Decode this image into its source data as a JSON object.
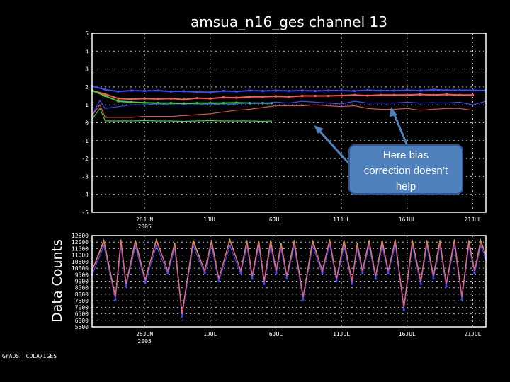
{
  "chart_data": [
    {
      "type": "line",
      "title": "amsua_n16_ges channel 13",
      "xlabel": "",
      "ylabel": "",
      "xlim_days": [
        0,
        30
      ],
      "ylim": [
        -5,
        5
      ],
      "yticks": [
        5,
        4,
        3,
        2,
        1,
        0,
        -1,
        -2,
        -3,
        -4,
        -5
      ],
      "xticks": [
        {
          "day": 4,
          "label": "26JUN",
          "sub": "2005"
        },
        {
          "day": 9,
          "label": "1JUL"
        },
        {
          "day": 14,
          "label": "6JUL"
        },
        {
          "day": 19,
          "label": "11JUL"
        },
        {
          "day": 24,
          "label": "16JUL"
        },
        {
          "day": 29,
          "label": "21JUL"
        }
      ],
      "grid": true,
      "series": [
        {
          "name": "blue-upper",
          "color": "#3a4dff",
          "x": [
            0,
            1,
            2,
            3,
            4,
            5,
            6,
            7,
            8,
            9,
            10,
            11,
            12,
            13,
            14,
            15,
            16,
            17,
            18,
            19,
            20,
            21,
            22,
            23,
            24,
            25,
            26,
            27,
            28,
            29,
            30
          ],
          "values": [
            2.05,
            1.85,
            1.75,
            1.8,
            1.78,
            1.8,
            1.75,
            1.76,
            1.72,
            1.7,
            1.78,
            1.75,
            1.8,
            1.78,
            1.8,
            1.78,
            1.8,
            1.78,
            1.8,
            1.8,
            1.78,
            1.82,
            1.8,
            1.8,
            1.82,
            1.8,
            1.85,
            1.82,
            1.82,
            1.82,
            1.8
          ]
        },
        {
          "name": "red-upper",
          "color": "#ff5a50",
          "x": [
            0,
            1,
            2,
            3,
            4,
            5,
            6,
            7,
            8,
            9,
            10,
            11,
            12,
            13,
            14,
            15,
            16,
            17,
            18,
            19,
            20,
            21,
            22,
            23,
            24,
            25,
            26,
            27,
            28,
            29
          ],
          "values": [
            1.8,
            1.6,
            1.35,
            1.32,
            1.35,
            1.33,
            1.35,
            1.3,
            1.38,
            1.35,
            1.42,
            1.4,
            1.45,
            1.45,
            1.48,
            1.45,
            1.5,
            1.5,
            1.5,
            1.52,
            1.55,
            1.52,
            1.55,
            1.55,
            1.55,
            1.58,
            1.55,
            1.58,
            1.55,
            1.55
          ]
        },
        {
          "name": "green-upper",
          "color": "#40d040",
          "x": [
            0,
            1,
            2,
            3,
            4,
            5,
            6,
            7,
            8,
            9,
            10,
            11,
            12,
            13,
            13.7
          ],
          "values": [
            1.8,
            1.5,
            1.2,
            1.15,
            1.12,
            1.1,
            1.1,
            1.08,
            1.1,
            1.1,
            1.1,
            1.12,
            1.1,
            1.1,
            1.1
          ]
        },
        {
          "name": "blue-lower",
          "color": "#3a4dff",
          "x": [
            0,
            0.6,
            1,
            2,
            3,
            4,
            5,
            6,
            7,
            8,
            9,
            10,
            11,
            12,
            13,
            14,
            15,
            16,
            17,
            18,
            19,
            20,
            21,
            22,
            23,
            24,
            25,
            26,
            27,
            28,
            29,
            30
          ],
          "values": [
            0.4,
            1.25,
            0.8,
            0.9,
            1.0,
            1.0,
            1.05,
            1.0,
            1.0,
            1.0,
            1.05,
            1.0,
            1.05,
            1.1,
            1.1,
            1.15,
            1.1,
            1.2,
            1.15,
            1.1,
            1.05,
            1.2,
            1.1,
            1.1,
            1.1,
            1.15,
            1.1,
            1.12,
            1.1,
            1.15,
            1.0,
            1.2
          ]
        },
        {
          "name": "red-lower",
          "color": "#e0504a",
          "x": [
            0,
            0.6,
            1,
            2,
            3,
            4,
            5.5,
            6,
            7,
            8,
            9,
            10,
            11,
            12,
            13,
            14,
            15,
            16,
            17,
            18,
            19,
            20,
            21,
            22,
            23,
            24,
            25,
            26,
            27,
            28,
            29
          ],
          "values": [
            0.4,
            1.0,
            0.3,
            0.3,
            0.3,
            0.35,
            0.35,
            0.35,
            0.4,
            0.45,
            0.5,
            0.6,
            0.7,
            0.75,
            0.85,
            0.95,
            0.95,
            0.95,
            1.0,
            0.95,
            0.9,
            0.95,
            0.8,
            0.75,
            0.75,
            0.8,
            0.7,
            0.75,
            0.8,
            0.8,
            0.7
          ]
        },
        {
          "name": "green-lower",
          "color": "#40d040",
          "x": [
            0,
            0.6,
            1,
            2,
            3,
            4,
            5,
            6,
            7,
            8,
            9,
            10,
            11,
            12,
            13,
            13.7
          ],
          "values": [
            0.2,
            0.8,
            0.1,
            0.1,
            0.1,
            0.12,
            0.1,
            0.1,
            0.08,
            0.1,
            0.12,
            0.1,
            0.1,
            0.1,
            0.08,
            0.1
          ]
        }
      ]
    },
    {
      "type": "line",
      "title": "",
      "xlabel": "",
      "ylabel": "Data Counts",
      "xlim_days": [
        0,
        30
      ],
      "ylim": [
        5500,
        12500
      ],
      "yticks": [
        12500,
        12000,
        11500,
        11000,
        10500,
        10000,
        9500,
        9000,
        8500,
        8000,
        7500,
        7000,
        6500,
        6000,
        5500
      ],
      "xticks": [
        {
          "day": 4,
          "label": "26JUN",
          "sub": "2005"
        },
        {
          "day": 9,
          "label": "1JUL"
        },
        {
          "day": 14,
          "label": "6JUL"
        },
        {
          "day": 19,
          "label": "11JUL"
        },
        {
          "day": 24,
          "label": "16JUL"
        },
        {
          "day": 29,
          "label": "21JUL"
        }
      ],
      "grid": true,
      "x": [
        0,
        0.9,
        1.78,
        2.2,
        2.59,
        3.3,
        4.05,
        4.9,
        5.77,
        6.3,
        6.85,
        7.7,
        8.58,
        9.1,
        9.66,
        10.5,
        11.33,
        11.8,
        12.2,
        12.7,
        13.11,
        13.6,
        14.03,
        14.4,
        14.84,
        15.4,
        16.08,
        16.8,
        17.54,
        18.1,
        18.62,
        19.2,
        19.8,
        20.2,
        20.6,
        21.1,
        21.6,
        22.1,
        22.56,
        23.1,
        23.75,
        24.4,
        25.04,
        25.5,
        26.0,
        26.5,
        26.98,
        27.6,
        28.17,
        28.7,
        29.14,
        29.6,
        30
      ],
      "series": [
        {
          "name": "green",
          "color": "#b0c040",
          "values": [
            9800,
            12150,
            7800,
            12200,
            8800,
            12150,
            9100,
            12200,
            9800,
            11950,
            6500,
            12150,
            9800,
            12150,
            9200,
            12200,
            9800,
            12150,
            9400,
            12150,
            9000,
            12150,
            9800,
            11950,
            9400,
            12150,
            7800,
            12150,
            9800,
            12200,
            9200,
            12150,
            9000,
            11950,
            9800,
            12150,
            9400,
            12150,
            9800,
            12200,
            7000,
            12150,
            9000,
            12150,
            9400,
            12150,
            8800,
            12200,
            7800,
            12150,
            9800,
            12150,
            11000
          ]
        },
        {
          "name": "blue",
          "color": "#3a4dff",
          "values": [
            9500,
            11700,
            7600,
            11700,
            8600,
            11700,
            8900,
            11700,
            9600,
            11500,
            6300,
            11700,
            9600,
            11700,
            9000,
            11700,
            9600,
            11700,
            9200,
            11700,
            8800,
            11700,
            9600,
            11500,
            9200,
            11700,
            7600,
            11700,
            9600,
            11800,
            9000,
            11700,
            8800,
            11500,
            9600,
            11700,
            9200,
            11700,
            9600,
            11800,
            6800,
            11700,
            8800,
            11700,
            9200,
            11700,
            8600,
            11800,
            7600,
            11700,
            9600,
            11700,
            10800
          ]
        },
        {
          "name": "red",
          "color": "#ff6060",
          "values": [
            9800,
            12000,
            7800,
            12100,
            8800,
            12000,
            9100,
            12100,
            9800,
            11800,
            6500,
            12000,
            9800,
            12000,
            9200,
            12100,
            9800,
            12000,
            9400,
            12000,
            9000,
            12000,
            9800,
            11800,
            9400,
            12000,
            7800,
            12000,
            9800,
            12100,
            9200,
            12000,
            9000,
            11800,
            9800,
            12000,
            9400,
            12000,
            9800,
            12100,
            7000,
            12000,
            9000,
            12000,
            9400,
            12000,
            8800,
            12100,
            7800,
            12000,
            9800,
            12000,
            11000
          ]
        }
      ]
    }
  ],
  "credit": "GrADS: COLA/IGES",
  "annotation": {
    "line1": "Here bias",
    "line2": "correction doesn’t",
    "line3": "help",
    "color": "#4f81bd"
  }
}
